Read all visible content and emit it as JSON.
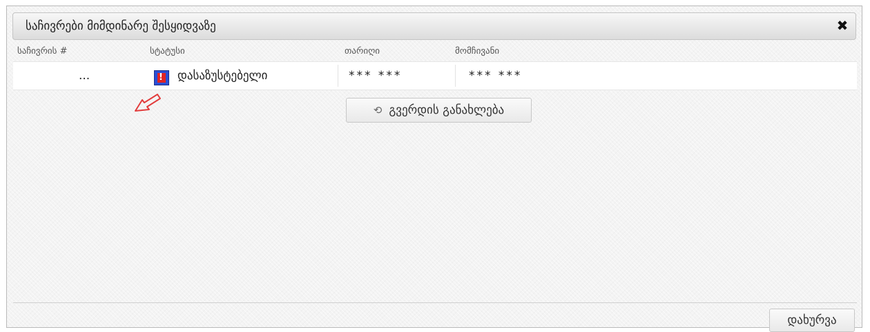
{
  "dialog": {
    "title": "საჩივრები მიმდინარე შესყიდვაზე",
    "close_symbol": "✖"
  },
  "table": {
    "headers": [
      "საჩივრის #",
      "სტატუსი",
      "თარიღი",
      "მომჩივანი"
    ],
    "rows": [
      {
        "complaint_no": "...",
        "status": "დასაზუსტებელი",
        "status_icon": "status-flag-icon",
        "date": "*** ***",
        "complainant": "*** ***"
      }
    ]
  },
  "buttons": {
    "refresh": "გვერდის განახლება",
    "refresh_icon": "refresh-icon",
    "close": "დახურვა"
  },
  "colors": {
    "arrow": "#e23c3c",
    "status_icon_bg": "#2a4fd6",
    "status_icon_fg": "#e02424"
  }
}
